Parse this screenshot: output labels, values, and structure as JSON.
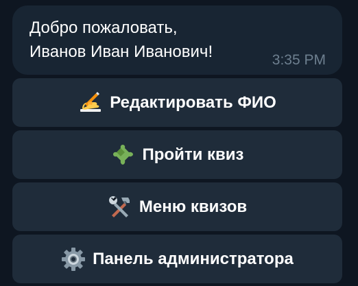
{
  "message": {
    "line1": "Добро пожаловать,",
    "line2": "Иванов Иван Иванович!",
    "time": "3:35 PM"
  },
  "keyboard": {
    "buttons": [
      {
        "label": "Редактировать ФИО",
        "icon": "writing-hand-icon"
      },
      {
        "label": "Пройти квиз",
        "icon": "puzzle-piece-icon"
      },
      {
        "label": "Меню квизов",
        "icon": "hammer-and-wrench-icon"
      },
      {
        "label": "Панель администратора",
        "icon": "gear-icon"
      }
    ]
  },
  "colors": {
    "background": "#0e1621",
    "bubble": "#182533",
    "button": "#1f2c3a",
    "text": "#ffffff",
    "time": "#6d7f8f"
  }
}
